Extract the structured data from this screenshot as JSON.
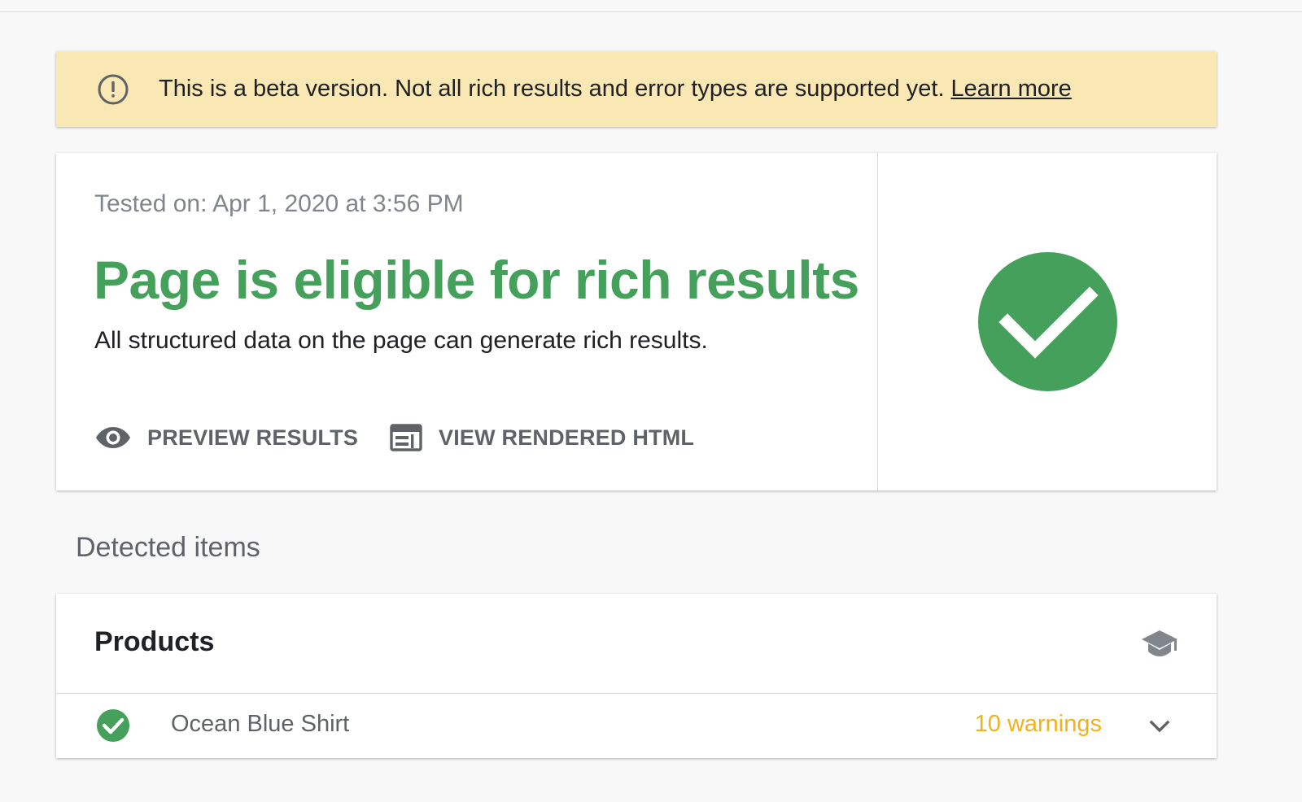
{
  "banner": {
    "message": "This is a beta version. Not all rich results and error types are supported yet.",
    "link_label": "Learn more",
    "icon": "warning-circle-icon",
    "background_color": "#f9e7b4"
  },
  "result": {
    "tested_on": "Tested on: Apr 1, 2020 at 3:56 PM",
    "headline": "Page is eligible for rich results",
    "subline": "All structured data on the page can generate rich results.",
    "status_color": "#44a05a",
    "status_icon": "check-circle-icon",
    "actions": [
      {
        "label": "PREVIEW RESULTS",
        "icon": "eye-icon"
      },
      {
        "label": "VIEW RENDERED HTML",
        "icon": "web-page-icon"
      }
    ]
  },
  "detected": {
    "section_label": "Detected items",
    "cards": [
      {
        "title": "Products",
        "header_icon": "school-cap-icon",
        "items": [
          {
            "name": "Ocean Blue Shirt",
            "status_icon": "check-circle-icon",
            "warnings": "10 warnings",
            "warnings_color": "#f2b21c",
            "expand_icon": "chevron-down-icon"
          }
        ]
      }
    ]
  }
}
